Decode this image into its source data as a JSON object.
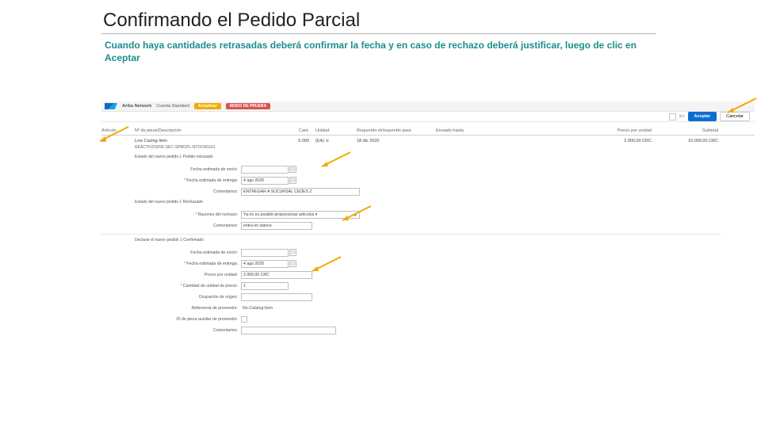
{
  "slide": {
    "title": "Confirmando el Pedido Parcial",
    "subtitle": "Cuando haya cantidades retrasadas deberá confirmar la fecha y en caso de rechazo deberá justificar, luego de clic en Aceptar"
  },
  "topbar": {
    "brand": "Ariba Network",
    "account": "Cuenta Standard",
    "upgrade": "Actualizar",
    "mode": "MODO DE PRUEBA"
  },
  "actions": {
    "accept": "Aceptar",
    "cancel": "Cancelar"
  },
  "table": {
    "headers": {
      "line": "Artículo",
      "part": "Nº de pieza/Descripción",
      "qty": "Cant.",
      "unit": "Unidad",
      "need": "Requerido el/requerido para",
      "ship": "Enviado hasta",
      "price": "Precio por unidad",
      "subtotal": "Subtotal"
    },
    "row": {
      "line": "10",
      "part": "Low Casing Item",
      "part2": "REACTIVOSPIE-SEC-SPMCPL-NTOCM1161",
      "qty": "5.000",
      "unit": "(EA) ①",
      "need": "18 dic 2020",
      "ship": "",
      "price": "2.000,00 CRC",
      "subtotal": "10.000,00 CRC"
    },
    "backorder_status": "Estado del nuevo pedido   1 Pedido retrasado",
    "backorder": {
      "est_ship_label": "Fecha estimada de envío:",
      "est_deliv_label": "Fecha estimada de entrega:",
      "est_deliv_value": "4 ago 2020",
      "comments_label": "Comentarios:",
      "comments_value": "ENTREGAR A SUCURSAL CEDES 2",
      "reject_status": "Estado del nuevo pedido   1 Rechazado",
      "reject_reason_label": "Razones del rechazo:",
      "reject_reason_value": "Ya no es posible proporcionar articulos ▾",
      "reject_comments_label": "Comentarios:",
      "reject_comments_value": "entra en stance"
    },
    "confirmed_status": "Declarar el nuevo pedido   1 Confirmado",
    "confirmed": {
      "ship_date_label": "Fecha estimada de envío:",
      "deliv_date_label": "Fecha estimada de entrega:",
      "deliv_date_value": "4 ago 2020",
      "unit_price_label": "Precio por unidad:",
      "unit_price_value": "2.000,00 CRC",
      "price_unit_qty_label": "Cantidad de unidad de precio:",
      "price_unit_qty_value": "1",
      "origin_label": "Ocupación de origen:",
      "supplier_part_label": "Referencia de proveedor:",
      "supplier_part_value": "No-Catalog-Item",
      "aux_part_label": "ID de pieza auxiliar de proveedor:",
      "comments_label": "Comentarios:"
    }
  }
}
